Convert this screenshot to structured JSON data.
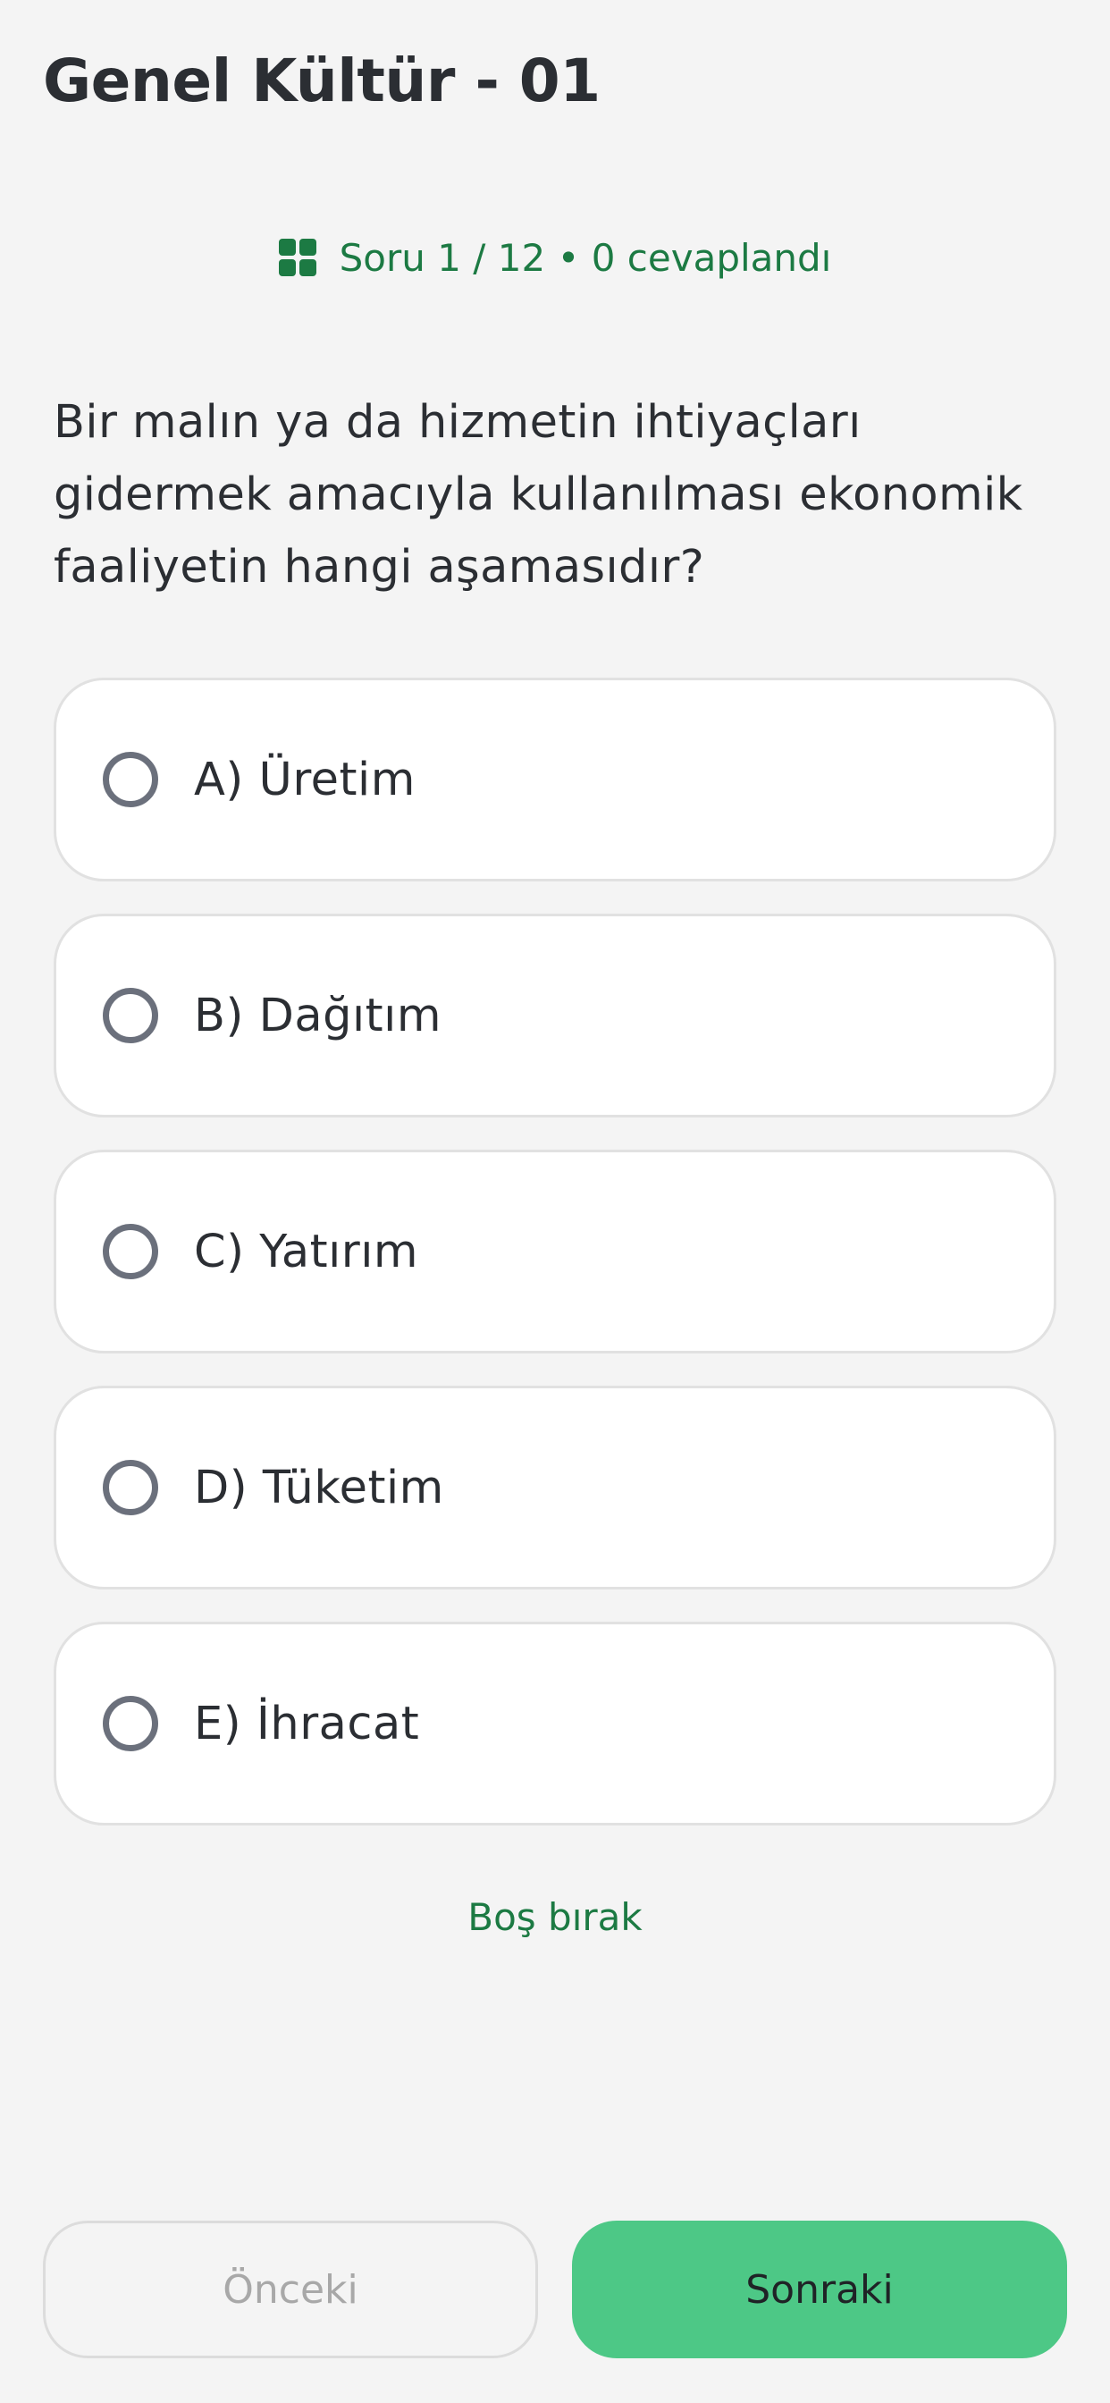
{
  "header": {
    "title": "Genel Kültür - 01"
  },
  "progress": {
    "icon": "grid-icon",
    "text": "Soru 1 / 12 • 0 cevaplandı",
    "color": "#1c7a43"
  },
  "question": {
    "text": "Bir malın ya da hizmetin ihtiyaçları gidermek amacıyla kullanılması ekonomik faaliyetin hangi aşamasıdır?"
  },
  "options": [
    {
      "label": "A) Üretim"
    },
    {
      "label": "B) Dağıtım"
    },
    {
      "label": "C) Yatırım"
    },
    {
      "label": "D) Tüketim"
    },
    {
      "label": "E) İhracat"
    }
  ],
  "skip": {
    "label": "Boş bırak"
  },
  "footer": {
    "prev_label": "Önceki",
    "next_label": "Sonraki",
    "accent": "#4dc886"
  }
}
